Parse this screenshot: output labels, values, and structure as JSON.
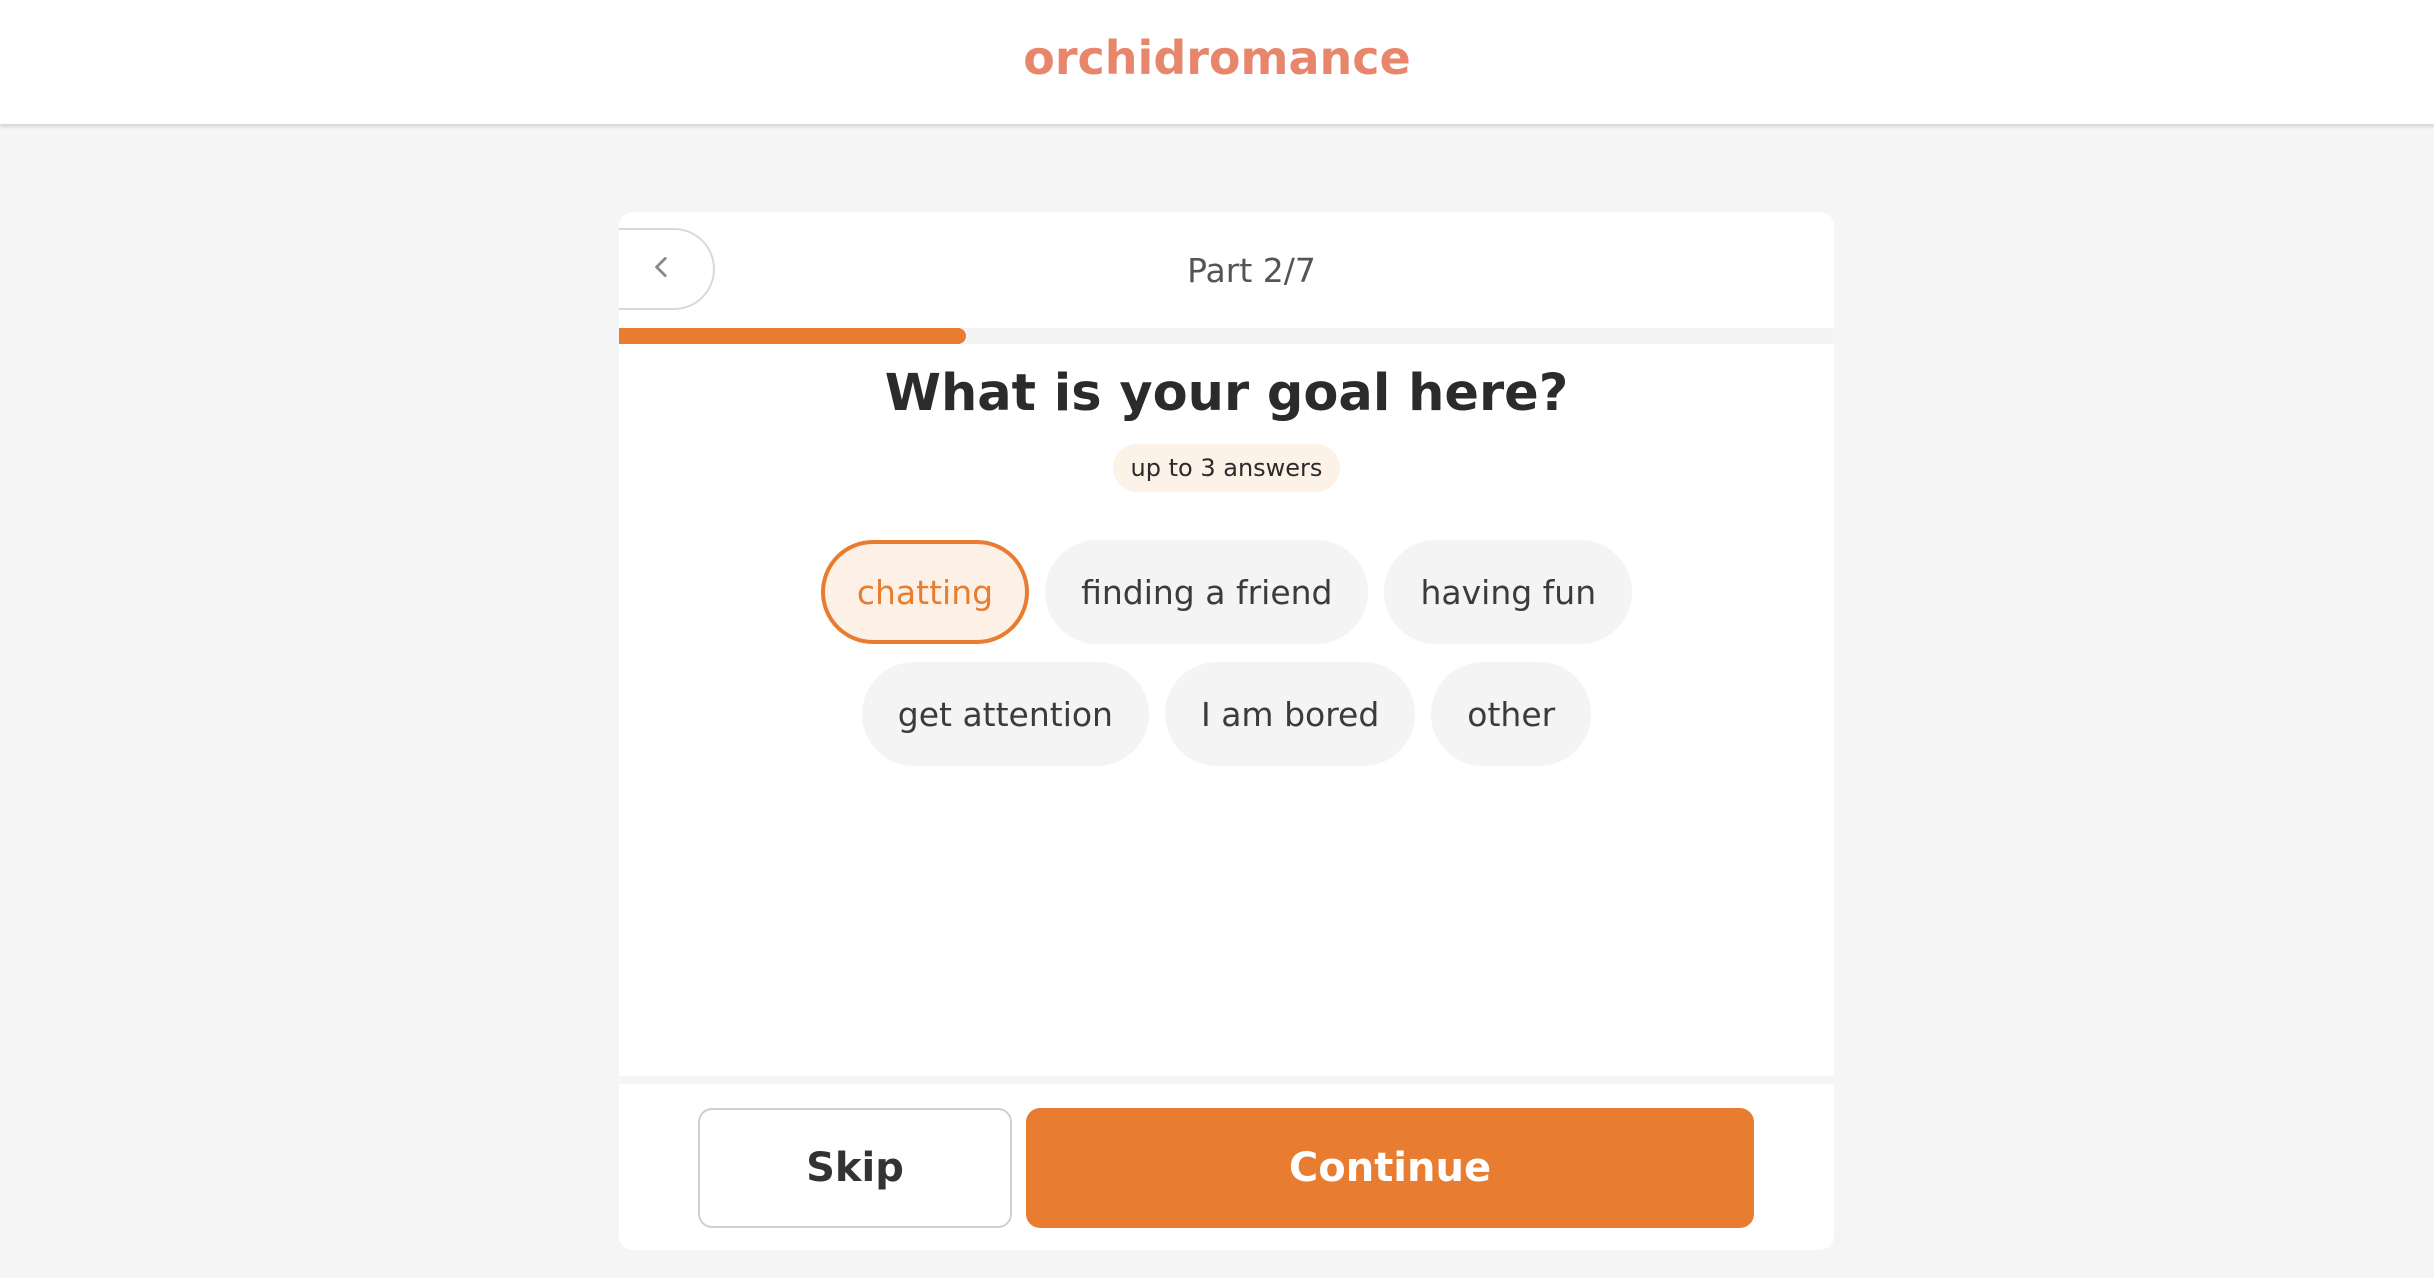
{
  "app": {
    "logo_text": "orchidromance",
    "brand_color": "#e8866b",
    "accent_color": "#e87c30"
  },
  "header": {
    "back_icon": "chevron-left-icon",
    "part_label": "Part 2/7",
    "progress_fraction": 0.2857
  },
  "question": {
    "title": "What is your goal here?",
    "hint": "up to 3 answers"
  },
  "options": [
    {
      "label": "chatting",
      "selected": true
    },
    {
      "label": "finding a friend",
      "selected": false
    },
    {
      "label": "having fun",
      "selected": false
    },
    {
      "label": "get attention",
      "selected": false
    },
    {
      "label": "I am bored",
      "selected": false
    },
    {
      "label": "other",
      "selected": false
    }
  ],
  "footer": {
    "skip_label": "Skip",
    "continue_label": "Continue"
  }
}
